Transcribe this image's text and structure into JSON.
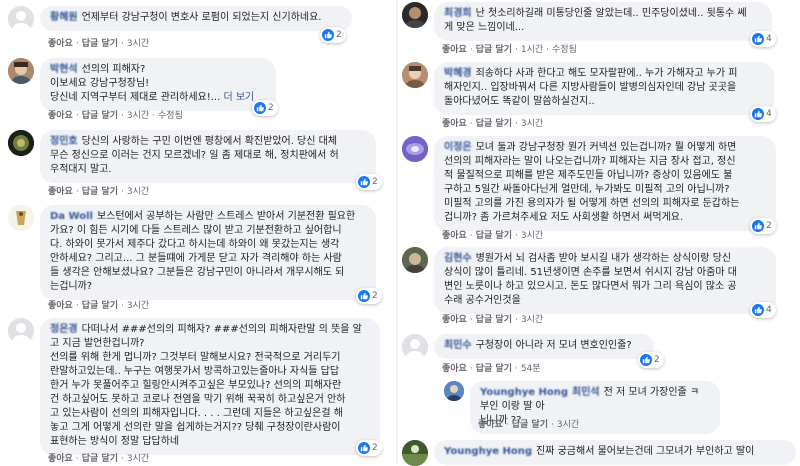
{
  "colors": {
    "like_blue": "#1877f2",
    "bubble_bg": "#f0f2f5",
    "link": "#385898",
    "meta_gray": "#65676b"
  },
  "action_labels": {
    "like": "좋아요",
    "reply": "답글 달기",
    "edit": "수정됨"
  },
  "left": [
    {
      "author": "황혜원",
      "lines": [
        "언제부터 강남구청이 변호사 로펌이 되었는지 신기하네요."
      ],
      "time": "3시간",
      "reactions": "2"
    },
    {
      "author": "박현석",
      "lines": [
        "선의의 피해자?",
        "이보세요 강남구청장님!",
        "당신네 지역구부터 제대로 관리하세요!..."
      ],
      "more": "더 보기",
      "time": "3시간",
      "edited": true,
      "reactions": "2"
    },
    {
      "author": "정민호",
      "lines": [
        "당신의 사랑하는 구민 이번엔 평창에서 확진받았어. 당신 대체",
        "무슨 정신으로 이러는 건지 모르겠네? 일 좀 제대로 해, 정치판에서 허",
        "우적대지 말고."
      ],
      "time": "3시간",
      "reactions": "2"
    },
    {
      "author": "Da Woll",
      "lines": [
        "보스턴에서 공부하는 사람만 스트레스 받아서 기분전환 필요한",
        "가요? 이 힘든 시기에 다들 스트레스 많이 받고 기분전환하고 싶어합니",
        "다. 하와이 못가서 제주다 갔다고 하시는데 하와이 왜 못갔는지는 생각",
        "안하세요? 그리고... 그 분들떄에 가게문 닫고 자가 격리해야 하는 사람",
        "들 생각은 안해보셨나요? 그분들은 강남구민이 아니라서 개무시해도 되",
        "는겁니까?"
      ],
      "time": "3시간",
      "reactions": "2"
    },
    {
      "author": "정은경",
      "lines": [
        "다떠나서 ###선의의 피해자? ###선의의 피해자란말 의 뜻을 알",
        "고 지금 발언한겁니까?",
        "선의를 위해 한게 멉니까? 그것부터 말해보시요? 전국적으로 거리두기",
        "란말하고있는데.. 누구는 여행못가서 방콕하고있는줄아나 자식들 답답",
        "한거 누가 못풀어주고 힐링안시켜주고싶은 부모있나? 선의의 피해자란",
        "건 하고싶어도 못하고 코로나 전염을 막기 위해 꾹꾹히 하고싶은거 안하",
        "고 있는사람이 선의의 피해자입니다. . . . 그런데 지들은 하고싶은걸 해",
        "놓고 그게 어떻게 선의란 말을 쉽게하는거지?? 당췌 구청장이란사람이",
        "표현하는 방식이 정말 답답하네"
      ],
      "time": "3시간",
      "reactions": "2"
    }
  ],
  "right": [
    {
      "author": "최경희",
      "lines": [
        "난 첫소리하길래 미통당인줄 알았는데.. 민주당이셨네.. 뒷통수 쎄",
        "게 맞은 느낌이네..."
      ],
      "time": "1시간",
      "edited": true,
      "reactions": "4"
    },
    {
      "author": "박혜경",
      "lines": [
        "죄송하다 사과 한다고 해도 모자랄판에.. 누가 가해자고 누가 피",
        "해자인지.. 입장바꿔서 다른 지방사람들이 발병의심자인데 강남 곳곳을",
        "돌아다녔어도 똑같이 말씀하실건지.."
      ],
      "time": "3시간",
      "reactions": "4"
    },
    {
      "author": "이정은",
      "lines": [
        "모녀 둘과 강남구청장 뭔가 커넥션 있는겁니까? 뭘 어떻게 하면",
        "선의의 피해자라는 말이 나오는겁니까? 피해자는 지금 장사 접고, 정신",
        "적 물질적으로 피해를 받은 제주도민들 아닙니까? 증상이 있음에도 불",
        "구하고 5일간 싸돌아다닌게 얼만데, 누가봐도 미필적 고의 아닙니까?",
        "미필적 고의를 가진 용의자가 될 어떻게 하면 선의의 피해자로 둔갑하는",
        "겁니까? 좀 가르쳐주세요 저도 사회생활 하면서 써먹게요."
      ],
      "time": "3시간",
      "reactions": "2"
    },
    {
      "author": "김현수",
      "lines": [
        "병원가서 뇌 검사좀 받아 보시길 내가 생각하는 상식이랑 당신",
        "상식이 많이 틀리네. 51년생이면 손주를 보면서 쉬시지 강남 아줌마 대",
        "변인 노릇이나 하고 있으시고. 돈도 많다면서 뭐가 그리 욕심이 많소 공",
        "수래 공수거인것을"
      ],
      "time": "3시간",
      "reactions": "4"
    },
    {
      "author": "최민수",
      "lines": [
        "구청장이 아니라 저 모녀 변호인인줄?"
      ],
      "time": "54분",
      "reactions": "2"
    },
    {
      "author": "Younghye Hong",
      "author2": "최민석",
      "lines": [
        "전 저 모녀 가장인줄 ㅋ 부인 이랑 딸 아",
        "닙니까 ??"
      ],
      "time": "3시간"
    },
    {
      "author": "Younghye Hong",
      "lines": [
        "진짜 궁금해서 물어보는건데 그모녀가 부인하고 딸이"
      ]
    }
  ]
}
